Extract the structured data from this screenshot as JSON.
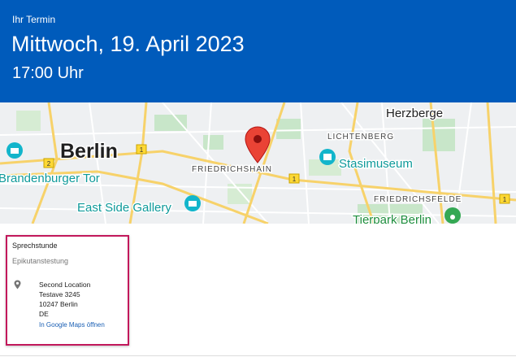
{
  "header": {
    "label": "Ihr Termin",
    "date": "Mittwoch, 19. April 2023",
    "time": "17:00 Uhr"
  },
  "map": {
    "places": {
      "berlin": "Berlin",
      "herzberge": "Herzberge",
      "lichtenberg": "LICHTENBERG",
      "friedrichshain": "FRIEDRICHSHAIN",
      "friedrichsfelde": "FRIEDRICHSFELDE",
      "stasimuseum": "Stasimuseum",
      "brandenburger_tor": "Brandenburger Tor",
      "east_side_gallery": "East Side Gallery",
      "tierpark": "Tierpark Berlin"
    },
    "road_badges": [
      "1",
      "2",
      "1",
      "1"
    ],
    "colors": {
      "marker": "#ea4335",
      "poi": "#12b5cb",
      "road": "#f7d26a"
    }
  },
  "appointment": {
    "title": "Sprechstunde",
    "type": "Epikutanstestung",
    "location_name": "Second Location",
    "street": "Testave 3245",
    "city": "10247 Berlin",
    "country": "DE",
    "maps_link": "In Google Maps öffnen",
    "location_icon": "location-pin-icon"
  }
}
